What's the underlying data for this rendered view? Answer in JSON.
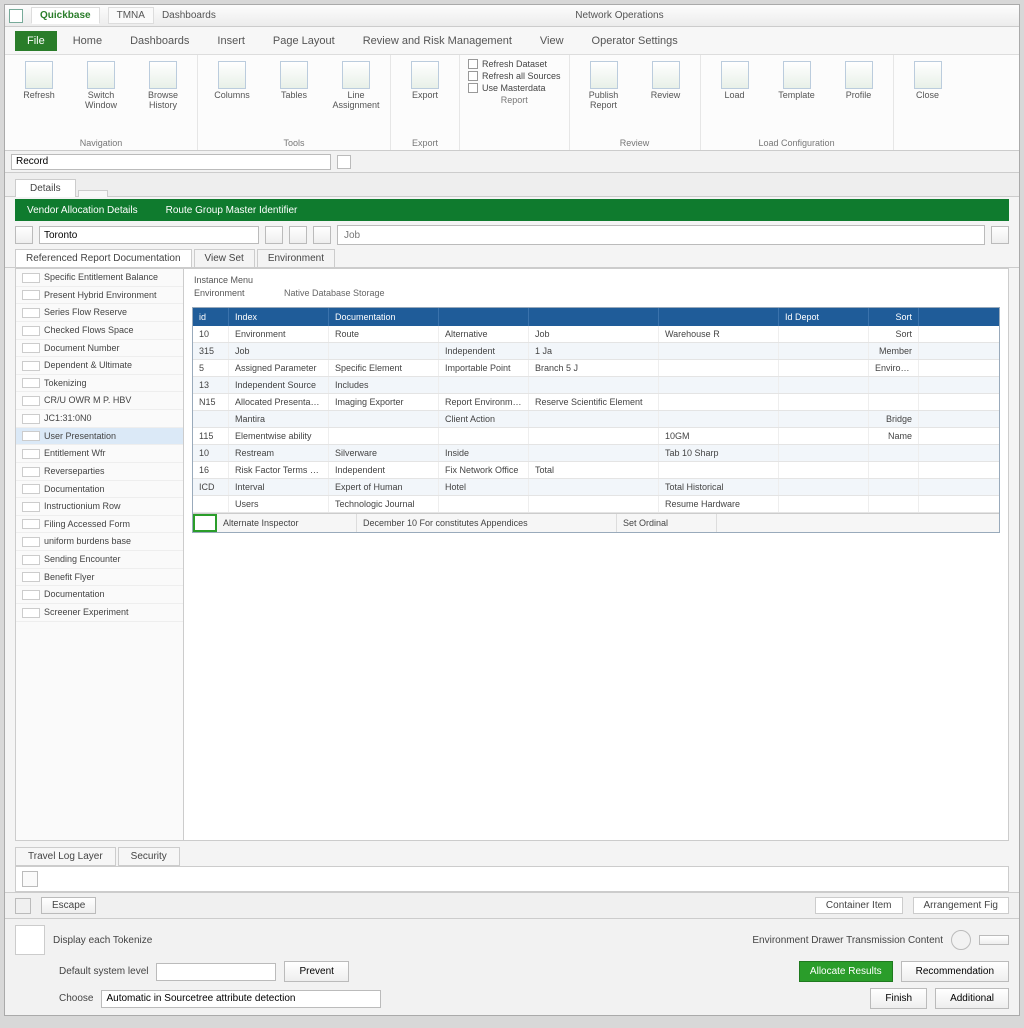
{
  "title": {
    "app_icon": "spreadsheet-icon",
    "product": "Quickbase",
    "doc": "TMNA",
    "subtitle": "Dashboards",
    "center": "Network Operations"
  },
  "ribbon_tabs": [
    "File",
    "Home",
    "Dashboards",
    "Insert",
    "Page Layout",
    "Review and Risk Management",
    "View",
    "Operator Settings"
  ],
  "ribbon": {
    "groups": [
      {
        "label": "Navigation",
        "buttons": [
          "Refresh",
          "Switch Window",
          "Browse History"
        ]
      },
      {
        "label": "Tools",
        "buttons": [
          "Columns",
          "Tables",
          "Line Assignment"
        ]
      },
      {
        "label": "Export",
        "buttons": [
          "Export"
        ]
      },
      {
        "label": "Report",
        "checks": [
          "Refresh Dataset",
          "Refresh all Sources",
          "Use Masterdata"
        ]
      },
      {
        "label": "Review",
        "buttons": [
          "Publish Report",
          "Review"
        ]
      },
      {
        "label": "Load Configuration",
        "buttons": [
          "Load",
          "Template",
          "Profile"
        ]
      },
      {
        "label": "",
        "buttons": [
          "Close"
        ]
      }
    ]
  },
  "namebox": "Record",
  "tabs": [
    "Details"
  ],
  "banner": {
    "left": "Vendor Allocation Details",
    "right": "Route Group Master Identifier"
  },
  "toolbar": {
    "field1": "Toronto",
    "search_placeholder": "Job"
  },
  "subtabs": [
    "Referenced Report Documentation",
    "View Set",
    "Environment"
  ],
  "sidebar": [
    "Specific Entitlement Balance",
    "Present Hybrid Environment",
    "Series Flow Reserve",
    "Checked Flows Space",
    "Document Number",
    "Dependent & Ultimate",
    "Tokenizing",
    "CR/U OWR M P. HBV",
    "JC1:31:0N0",
    "User Presentation",
    "Entitlement Wfr",
    "Reverseparties",
    "Documentation",
    "Instructionium Row",
    "Filing Accessed Form",
    "uniform burdens base",
    "Sending Encounter",
    "Benefit Flyer",
    "Documentation",
    "Screener Experiment"
  ],
  "meta": {
    "k1": "Instance Menu",
    "v1": "",
    "k2": "Environment",
    "v2": "Native Database Storage"
  },
  "grid": {
    "headers": [
      "id",
      "Index",
      "Documentation",
      "",
      "",
      "",
      "Id Depot",
      "Sort"
    ],
    "rows": [
      [
        "10",
        "Environment",
        "Route",
        "Alternative",
        "Job",
        "Warehouse R",
        "",
        "Sort"
      ],
      [
        "315",
        "Job",
        "",
        "Independent",
        "1 Ja",
        "",
        "",
        "Member"
      ],
      [
        "5",
        "Assigned Parameter",
        "Specific Element",
        "Importable Point",
        "Branch 5 J",
        "",
        "",
        "Environment"
      ],
      [
        "13",
        "Independent Source",
        "Includes",
        "",
        "",
        "",
        "",
        ""
      ],
      [
        "N15",
        "Allocated Presentation",
        "Imaging Exporter",
        "Report Environment Interface",
        "Reserve Scientific Element",
        "",
        "",
        ""
      ],
      [
        "",
        "Mantira",
        "",
        "Client Action",
        "",
        "",
        "",
        "Bridge"
      ],
      [
        "115",
        "Elementwise ability",
        "",
        "",
        "",
        "10GM",
        "",
        "Name"
      ],
      [
        "10",
        "Restream",
        "Silverware",
        "Inside",
        "",
        "Tab 10 Sharp",
        "",
        ""
      ],
      [
        "16",
        "Risk Factor Terms Vel",
        "Independent",
        "Fix Network Office",
        "Total",
        "",
        "",
        ""
      ],
      [
        "ICD",
        "Interval",
        "Expert of Human",
        "Hotel",
        "",
        "Total Historical",
        "",
        ""
      ],
      [
        "",
        "Users",
        "Technologic Journal",
        "",
        "",
        "Resume Hardware",
        "",
        ""
      ]
    ],
    "footer": [
      "",
      "Alternate Inspector",
      "December 10 For constitutes Appendices",
      "Set Ordinal"
    ]
  },
  "lowtabs": [
    "Travel Log Layer",
    "Security"
  ],
  "status_btn": "Escape",
  "pills": [
    "Container Item",
    "Arrangement Fig"
  ],
  "footer": {
    "hint": "Environment Drawer Transmission Content",
    "field1_label": "Display each Tokenize",
    "field2_label": "Default system level",
    "field2_btn": "Prevent",
    "field3_label": "Choose",
    "field3_value": "Automatic in Sourcetree attribute detection",
    "cta": "Allocate Results",
    "btn_secondary": "Recommendation",
    "btn_ok": "Finish",
    "btn_cancel": "Additional"
  }
}
